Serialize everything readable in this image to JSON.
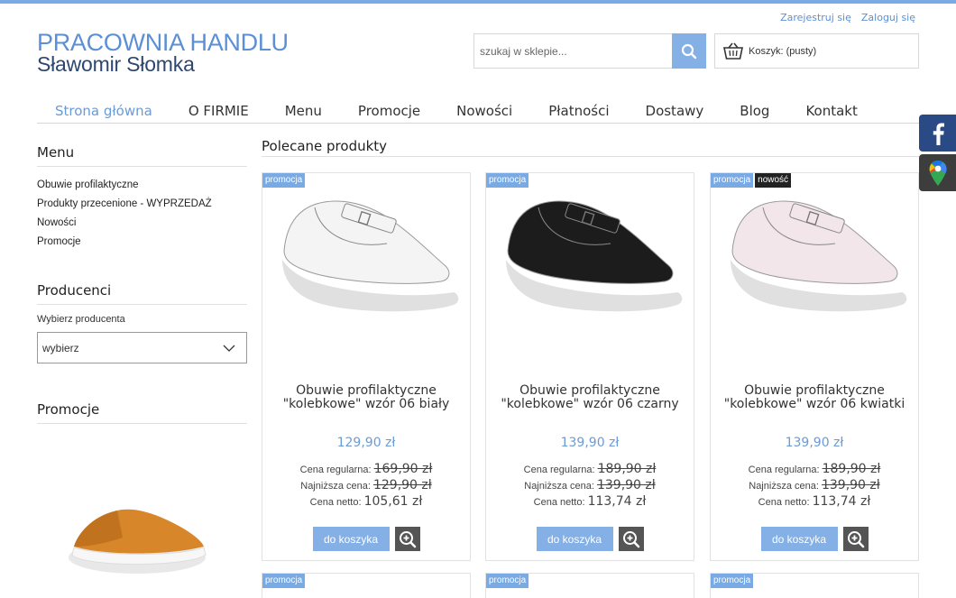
{
  "header": {
    "register": "Zarejestruj się",
    "login": "Zaloguj się",
    "logo_line1": "PRACOWNIA HANDLU",
    "logo_line2": "Sławomir Słomka",
    "search_placeholder": "szukaj w sklepie...",
    "cart_label": "Koszyk: (pusty)",
    "search_icon": "magnifier-icon",
    "cart_icon": "basket-icon"
  },
  "nav": [
    "Strona główna",
    "O FIRMIE",
    "Menu",
    "Promocje",
    "Nowości",
    "Płatności",
    "Dostawy",
    "Blog",
    "Kontakt"
  ],
  "side_icons": [
    "facebook-icon",
    "google-maps-icon"
  ],
  "sidebar": {
    "menu_title": "Menu",
    "menu_items": [
      "Obuwie profilaktyczne",
      "Produkty przecenione - WYPRZEDAŻ",
      "Nowości",
      "Promocje"
    ],
    "producers_title": "Producenci",
    "producers_label": "Wybierz producenta",
    "producers_select": "wybierz",
    "promo_title": "Promocje"
  },
  "main": {
    "title": "Polecane produkty",
    "labels": {
      "regular": "Cena regularna:",
      "lowest": "Najniższa cena:",
      "net": "Cena netto:",
      "buy": "do koszyka"
    },
    "products": [
      {
        "badges": [
          "promocja"
        ],
        "title1": "Obuwie profilaktyczne",
        "title2": "\"kolebkowe\" wzór 06 biały",
        "price": "129,90 zł",
        "regular": "169,90 zł",
        "lowest": "129,90 zł",
        "net": "105,61 zł",
        "color": "#f4f4f4"
      },
      {
        "badges": [
          "promocja"
        ],
        "title1": "Obuwie profilaktyczne",
        "title2": "\"kolebkowe\" wzór 06 czarny",
        "price": "139,90 zł",
        "regular": "189,90 zł",
        "lowest": "139,90 zł",
        "net": "113,74 zł",
        "color": "#1c1c1c"
      },
      {
        "badges": [
          "promocja",
          "nowość"
        ],
        "title1": "Obuwie profilaktyczne",
        "title2": "\"kolebkowe\" wzór 06 kwiatki",
        "price": "139,90 zł",
        "regular": "189,90 zł",
        "lowest": "139,90 zł",
        "net": "113,74 zł",
        "color": "#f3e6ea"
      }
    ],
    "second_row_badges": [
      "promocja",
      "promocja",
      "promocja"
    ]
  },
  "colors": {
    "accent": "#7aaae3",
    "link": "#5b8fd6",
    "button": "#84b0e6"
  }
}
